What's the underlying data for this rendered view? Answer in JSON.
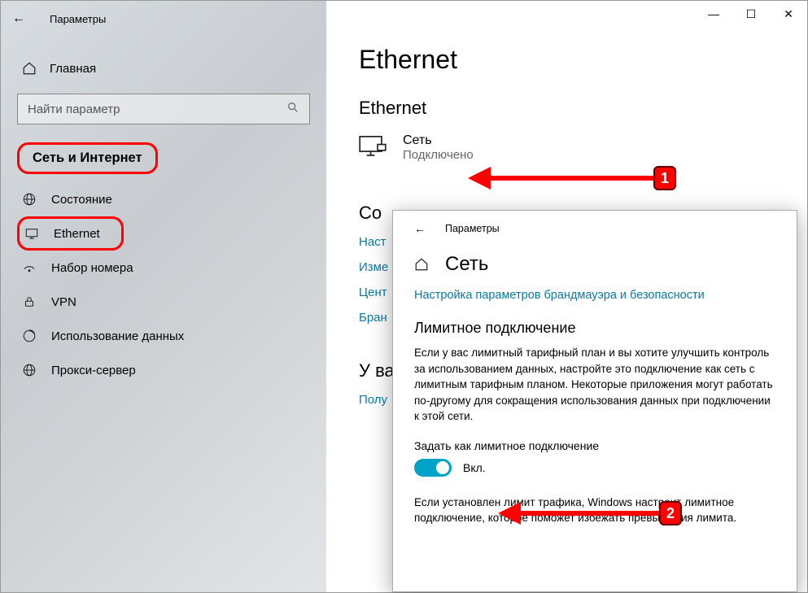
{
  "titlebar": {
    "label": "Параметры"
  },
  "sidebar": {
    "home": "Главная",
    "search_placeholder": "Найти параметр",
    "group": "Сеть и Интернет",
    "items": [
      {
        "label": "Состояние"
      },
      {
        "label": "Ethernet"
      },
      {
        "label": "Набор номера"
      },
      {
        "label": "VPN"
      },
      {
        "label": "Использование данных"
      },
      {
        "label": "Прокси-сервер"
      }
    ]
  },
  "main": {
    "title": "Ethernet",
    "section": "Ethernet",
    "network": {
      "name": "Сеть",
      "status": "Подключено"
    },
    "related_heading_partial": "Со",
    "links": {
      "l1": "Наст",
      "l2": "Изме",
      "l3": "Цент",
      "l4": "Бран"
    },
    "question_heading_partial": "У ва",
    "help_link": "Полу"
  },
  "annotations": {
    "badge1": "1",
    "badge2": "2"
  },
  "popup": {
    "header": "Параметры",
    "title": "Сеть",
    "firewall_link": "Настройка параметров брандмауэра и безопасности",
    "section": "Лимитное подключение",
    "body": "Если у вас лимитный тарифный план и вы хотите улучшить контроль за использованием данных, настройте это подключение как сеть с лимитным тарифным планом. Некоторые приложения могут работать по-другому для сокращения использования данных при подключении к этой сети.",
    "toggle_label": "Задать как лимитное подключение",
    "toggle_state": "Вкл.",
    "note": "Если установлен лимит трафика, Windows настроит лимитное подключение, которое поможет избежать превышения лимита."
  }
}
